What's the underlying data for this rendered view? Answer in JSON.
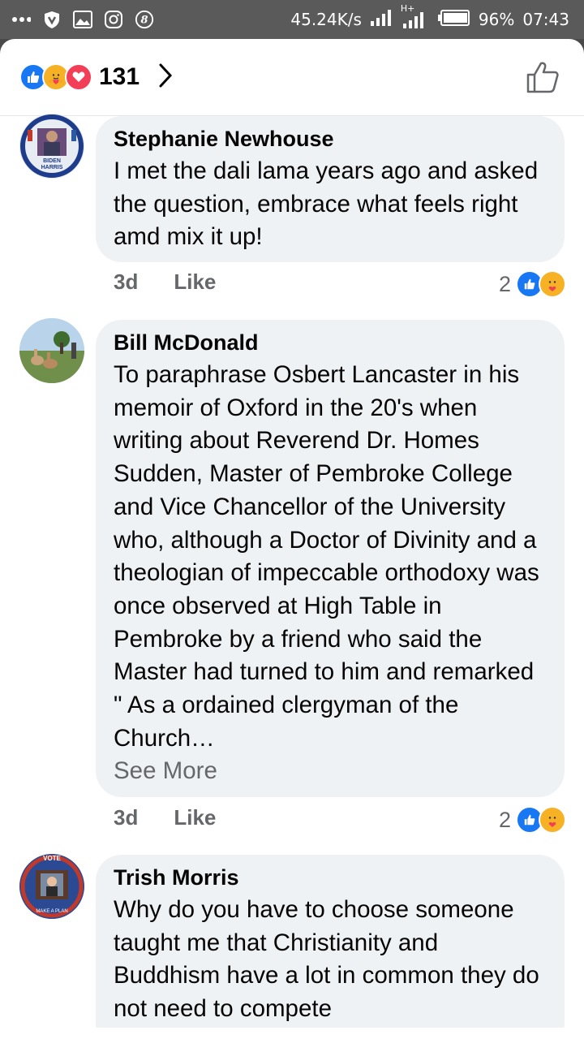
{
  "status_bar": {
    "left_icons": [
      "more-dots-icon",
      "shield-v-icon",
      "gallery-icon",
      "instagram-icon",
      "b-circle-icon"
    ],
    "speed": "45.24K/s",
    "network": "H+",
    "battery": "96%",
    "time": "07:43"
  },
  "header": {
    "reactions": [
      "like",
      "care",
      "love"
    ],
    "count": "131"
  },
  "colors": {
    "like_blue": "#1877f2",
    "love_red": "#f33e58",
    "care_yellow": "#f7b125",
    "bubble": "#eff2f5",
    "meta": "#65676b"
  },
  "comments": [
    {
      "author": "Stephanie Newhouse",
      "text": "I met the dali lama years ago and asked the  question, embrace what feels right amd mix it up!",
      "time": "3d",
      "like_label": "Like",
      "reaction_count": "2"
    },
    {
      "author": "Bill McDonald",
      "text": "To paraphrase Osbert Lancaster in his memoir of Oxford in the 20's when writing about Reverend Dr. Homes Sudden, Master of Pembroke College and Vice Chancellor of the University who, although a Doctor of Divinity and a theologian of impeccable orthodoxy was once observed at High Table in Pembroke by a friend who said the Master had turned to him and remarked \" As a ordained clergyman of the Church…",
      "see_more": "See More",
      "time": "3d",
      "like_label": "Like",
      "reaction_count": "2"
    },
    {
      "author": "Trish Morris",
      "text": "Why do you have to choose someone taught me that Christianity and Buddhism have a lot in common they do not need to compete"
    }
  ],
  "avatar_text": {
    "c0": "BIDEN HARRIS",
    "c2_top": "VOTE",
    "c2_bottom": "MAKE A PLAN"
  }
}
